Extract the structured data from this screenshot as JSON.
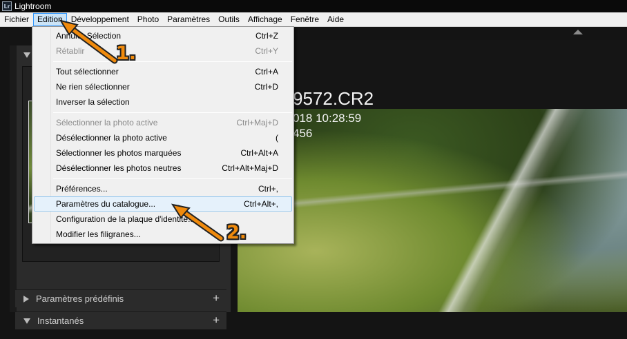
{
  "window": {
    "title": "Lightroom",
    "icon_text": "Lr"
  },
  "menubar": {
    "items": [
      "Fichier",
      "Edition",
      "Développement",
      "Photo",
      "Paramètres",
      "Outils",
      "Affichage",
      "Fenêtre",
      "Aide"
    ],
    "active_index": 1
  },
  "app": {
    "logo_text": "Lr",
    "photo": {
      "filename_fragment": "9572.CR2",
      "date_fragment": "018 10:28:59",
      "iso_fragment": "456"
    },
    "panels": [
      {
        "label": "Paramètres prédéfinis",
        "expanded": false
      },
      {
        "label": "Instantanés",
        "expanded": true
      }
    ]
  },
  "edit_menu": {
    "items": [
      {
        "label": "Annuler Sélection",
        "shortcut": "Ctrl+Z",
        "enabled": true
      },
      {
        "label": "Rétablir",
        "shortcut": "Ctrl+Y",
        "enabled": false
      },
      {
        "label": "Tout sélectionner",
        "shortcut": "Ctrl+A",
        "enabled": true
      },
      {
        "label": "Ne rien sélectionner",
        "shortcut": "Ctrl+D",
        "enabled": true
      },
      {
        "label": "Inverser la sélection",
        "shortcut": "",
        "enabled": true
      },
      {
        "label": "Sélectionner la photo active",
        "shortcut": "Ctrl+Maj+D",
        "enabled": false
      },
      {
        "label": "Désélectionner la photo active",
        "shortcut": "(",
        "enabled": true
      },
      {
        "label": "Sélectionner les photos marquées",
        "shortcut": "Ctrl+Alt+A",
        "enabled": true
      },
      {
        "label": "Désélectionner les photos neutres",
        "shortcut": "Ctrl+Alt+Maj+D",
        "enabled": true
      },
      {
        "label": "Préférences...",
        "shortcut": "Ctrl+,",
        "enabled": true
      },
      {
        "label": "Paramètres du catalogue...",
        "shortcut": "Ctrl+Alt+,",
        "enabled": true,
        "highlighted": true
      },
      {
        "label": "Configuration de la plaque d'identité...",
        "shortcut": "",
        "enabled": true
      },
      {
        "label": "Modifier les filigranes...",
        "shortcut": "",
        "enabled": true
      }
    ]
  },
  "annotations": {
    "step1": "1.",
    "step2": "2.",
    "color": "#f08a0c"
  }
}
